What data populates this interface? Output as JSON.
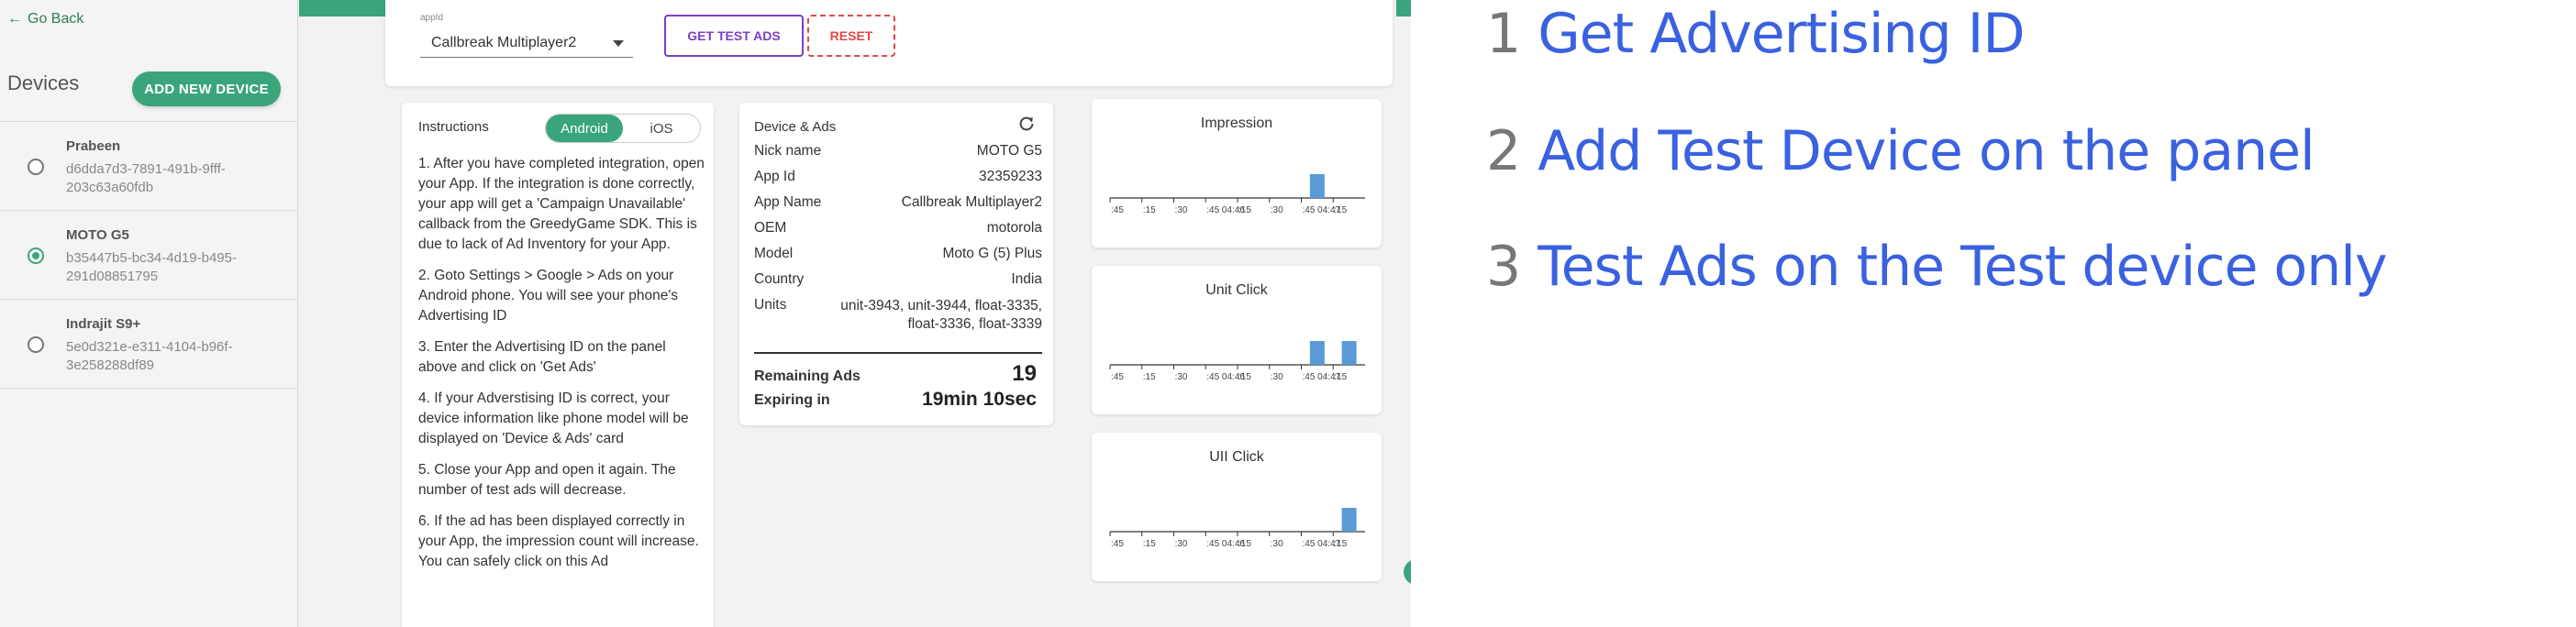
{
  "sidebar": {
    "go_back": "Go Back",
    "title": "Devices",
    "add_button": "ADD NEW DEVICE",
    "devices": [
      {
        "name": "Prabeen",
        "id": "d6dda7d3-7891-491b-9fff-203c63a60fdb",
        "selected": false
      },
      {
        "name": "MOTO G5",
        "id": "b35447b5-bc34-4d19-b495-291d08851795",
        "selected": true
      },
      {
        "name": "Indrajit S9+",
        "id": "5e0d321e-e311-4104-b96f-3e258288df89",
        "selected": false
      }
    ]
  },
  "toolbar": {
    "appid_label": "appId",
    "appid_value": "Callbreak Multiplayer2",
    "get_test_ads": "GET TEST ADS",
    "reset": "RESET"
  },
  "instructions": {
    "title": "Instructions",
    "tabs": [
      "Android",
      "iOS"
    ],
    "active_tab": "Android",
    "steps": [
      "1. After you have completed integration, open your App. If the integration is done correctly, your app will get a 'Campaign Unavailable' callback from the GreedyGame SDK. This is due to lack of Ad Inventory for your App.",
      "2. Goto Settings > Google > Ads on your Android phone. You will see your phone's Advertising ID",
      "3. Enter the Advertising ID on the panel above and click on 'Get Ads'",
      "4. If your Adverstising ID is correct, your device information like phone model will be displayed on 'Device & Ads' card",
      "5. Close your App and open it again. The number of test ads will decrease.",
      "6. If the ad has been displayed correctly in your App, the impression count will increase. You can safely click on this Ad"
    ]
  },
  "device_ads": {
    "title": "Device & Ads",
    "rows": [
      {
        "key": "Nick name",
        "value": "MOTO G5"
      },
      {
        "key": "App Id",
        "value": "32359233"
      },
      {
        "key": "App Name",
        "value": "Callbreak Multiplayer2"
      },
      {
        "key": "OEM",
        "value": "motorola"
      },
      {
        "key": "Model",
        "value": "Moto G (5) Plus"
      },
      {
        "key": "Country",
        "value": "India"
      },
      {
        "key": "Units",
        "value": "unit-3943, unit-3944, float-3335, float-3336, float-3339"
      }
    ],
    "remaining_label": "Remaining Ads",
    "remaining_value": "19",
    "expiring_label": "Expiring in",
    "expiring_value": "19min 10sec"
  },
  "chart_data": [
    {
      "type": "bar",
      "title": "Impression",
      "categories": [
        ":45",
        ":15",
        ":30",
        ":45 04:46",
        ":15",
        ":30",
        ":45 04:47",
        ":15"
      ],
      "values": [
        0,
        0,
        0,
        0,
        0,
        0,
        1,
        0
      ],
      "color": "#5b9bd5"
    },
    {
      "type": "bar",
      "title": "Unit Click",
      "categories": [
        ":45",
        ":15",
        ":30",
        ":45 04:46",
        ":15",
        ":30",
        ":45 04:47",
        ":15"
      ],
      "values": [
        0,
        0,
        0,
        0,
        0,
        0,
        1,
        1
      ],
      "color": "#5b9bd5"
    },
    {
      "type": "bar",
      "title": "UII Click",
      "categories": [
        ":45",
        ":15",
        ":30",
        ":45 04:46",
        ":15",
        ":30",
        ":45 04:47",
        ":15"
      ],
      "values": [
        0,
        0,
        0,
        0,
        0,
        0,
        0,
        1
      ],
      "color": "#5b9bd5"
    }
  ],
  "steps_list": [
    {
      "number": "1",
      "text": "Get Advertising ID"
    },
    {
      "number": "2",
      "text": "Add Test Device on the panel"
    },
    {
      "number": "3",
      "text": "Test Ads on the Test device only"
    }
  ],
  "colors": {
    "accent_green": "#3aa57a",
    "purple": "#7b3fc9",
    "red": "#e0484a",
    "link_blue": "#3a62e0"
  }
}
